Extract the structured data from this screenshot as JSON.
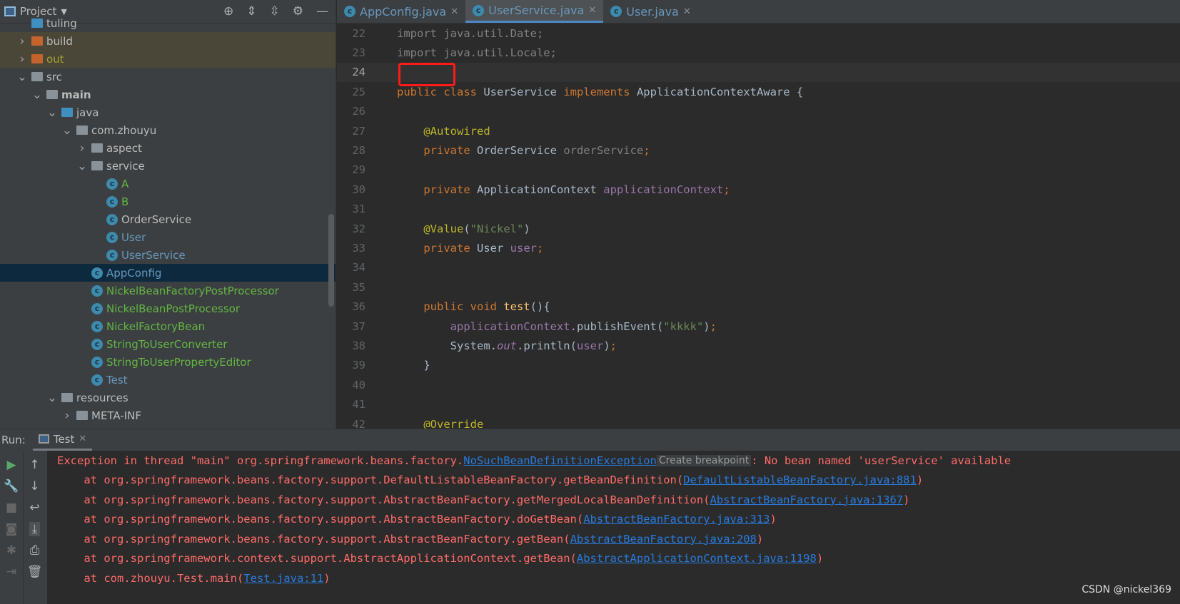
{
  "sidebar": {
    "title": "Project",
    "tree": [
      {
        "label": "tuling",
        "depth": 2,
        "type": "module",
        "arrow": ""
      },
      {
        "label": "build",
        "depth": 2,
        "type": "folder-orange",
        "arrow": ">",
        "excluded": true
      },
      {
        "label": "out",
        "depth": 2,
        "type": "folder-orange",
        "arrow": ">",
        "excluded": true,
        "color": "olive"
      },
      {
        "label": "src",
        "depth": 2,
        "type": "folder",
        "arrow": "v"
      },
      {
        "label": "main",
        "depth": 3,
        "type": "folder",
        "arrow": "v",
        "bold": true
      },
      {
        "label": "java",
        "depth": 4,
        "type": "folder-blue",
        "arrow": "v"
      },
      {
        "label": "com.zhouyu",
        "depth": 5,
        "type": "package",
        "arrow": "v"
      },
      {
        "label": "aspect",
        "depth": 6,
        "type": "package",
        "arrow": ">"
      },
      {
        "label": "service",
        "depth": 6,
        "type": "package",
        "arrow": "v"
      },
      {
        "label": "A",
        "depth": 7,
        "type": "class",
        "color": "green"
      },
      {
        "label": "B",
        "depth": 7,
        "type": "class",
        "color": "green"
      },
      {
        "label": "OrderService",
        "depth": 7,
        "type": "class"
      },
      {
        "label": "User",
        "depth": 7,
        "type": "class",
        "color": "blue"
      },
      {
        "label": "UserService",
        "depth": 7,
        "type": "class",
        "color": "blue"
      },
      {
        "label": "AppConfig",
        "depth": 6,
        "type": "class",
        "color": "blue",
        "selected": true
      },
      {
        "label": "NickelBeanFactoryPostProcessor",
        "depth": 6,
        "type": "class",
        "color": "green"
      },
      {
        "label": "NickelBeanPostProcessor",
        "depth": 6,
        "type": "class",
        "color": "green"
      },
      {
        "label": "NickelFactoryBean",
        "depth": 6,
        "type": "class",
        "color": "green"
      },
      {
        "label": "StringToUserConverter",
        "depth": 6,
        "type": "class",
        "color": "green"
      },
      {
        "label": "StringToUserPropertyEditor",
        "depth": 6,
        "type": "class",
        "color": "green"
      },
      {
        "label": "Test",
        "depth": 6,
        "type": "class",
        "color": "blue"
      },
      {
        "label": "resources",
        "depth": 4,
        "type": "folder",
        "arrow": "v"
      },
      {
        "label": "META-INF",
        "depth": 5,
        "type": "folder",
        "arrow": ">"
      }
    ]
  },
  "tabs": [
    {
      "label": "AppConfig.java"
    },
    {
      "label": "UserService.java",
      "active": true
    },
    {
      "label": "User.java"
    }
  ],
  "code": [
    {
      "n": "22",
      "h": "<span class='gray'>import java.util.Date;</span>"
    },
    {
      "n": "23",
      "h": "<span class='gray'>import java.util.Locale;</span>"
    },
    {
      "n": "24",
      "h": "",
      "cur": true
    },
    {
      "n": "25",
      "h": "<span class='kw'>public class </span>UserService <span class='kw'>implements </span>ApplicationContextAware {"
    },
    {
      "n": "26",
      "h": ""
    },
    {
      "n": "27",
      "h": "    <span class='an'>@Autowired</span>"
    },
    {
      "n": "28",
      "h": "    <span class='kw'>private </span>OrderService <span class='gray'>orderService</span><span class='kw'>;</span>"
    },
    {
      "n": "29",
      "h": ""
    },
    {
      "n": "30",
      "h": "    <span class='kw'>private </span>ApplicationContext <span class='fd'>applicationContext</span><span class='kw'>;</span>"
    },
    {
      "n": "31",
      "h": ""
    },
    {
      "n": "32",
      "h": "    <span class='an'>@Value</span>(<span class='st'>\"Nickel\"</span>)"
    },
    {
      "n": "33",
      "h": "    <span class='kw'>private </span>User <span class='fd'>user</span><span class='kw'>;</span>"
    },
    {
      "n": "34",
      "h": ""
    },
    {
      "n": "35",
      "h": ""
    },
    {
      "n": "36",
      "h": "    <span class='kw'>public void </span><span style='color:#ffc66d'>test</span>(){"
    },
    {
      "n": "37",
      "h": "        <span class='fd'>applicationContext</span>.publishEvent(<span class='st'>\"kkkk\"</span>)<span class='kw'>;</span>"
    },
    {
      "n": "38",
      "h": "        System.<span class='fd' style='font-style:italic'>out</span>.println(<span class='fd'>user</span>)<span class='kw'>;</span>"
    },
    {
      "n": "39",
      "h": "    }"
    },
    {
      "n": "40",
      "h": ""
    },
    {
      "n": "41",
      "h": ""
    },
    {
      "n": "42",
      "h": "    <span class='an'>@Override</span>"
    }
  ],
  "run": {
    "label": "Run:",
    "tab": "Test",
    "exception_prefix": "Exception in thread \"main\" org.springframework.beans.factory.",
    "exception_link": "NoSuchBeanDefinitionException",
    "tooltip": "Create breakpoint",
    "exception_suffix": ": No bean named 'userService' available",
    "stack": [
      {
        "pre": "    at org.springframework.beans.factory.support.DefaultListableBeanFactory.getBeanDefinition(",
        "link": "DefaultListableBeanFactory.java:881"
      },
      {
        "pre": "    at org.springframework.beans.factory.support.AbstractBeanFactory.getMergedLocalBeanDefinition(",
        "link": "AbstractBeanFactory.java:1367"
      },
      {
        "pre": "    at org.springframework.beans.factory.support.AbstractBeanFactory.doGetBean(",
        "link": "AbstractBeanFactory.java:313"
      },
      {
        "pre": "    at org.springframework.beans.factory.support.AbstractBeanFactory.getBean(",
        "link": "AbstractBeanFactory.java:208"
      },
      {
        "pre": "    at org.springframework.context.support.AbstractApplicationContext.getBean(",
        "link": "AbstractApplicationContext.java:1198"
      },
      {
        "pre": "    at com.zhouyu.Test.main(",
        "link": "Test.java:11"
      }
    ]
  },
  "watermark": "CSDN @nickel369"
}
